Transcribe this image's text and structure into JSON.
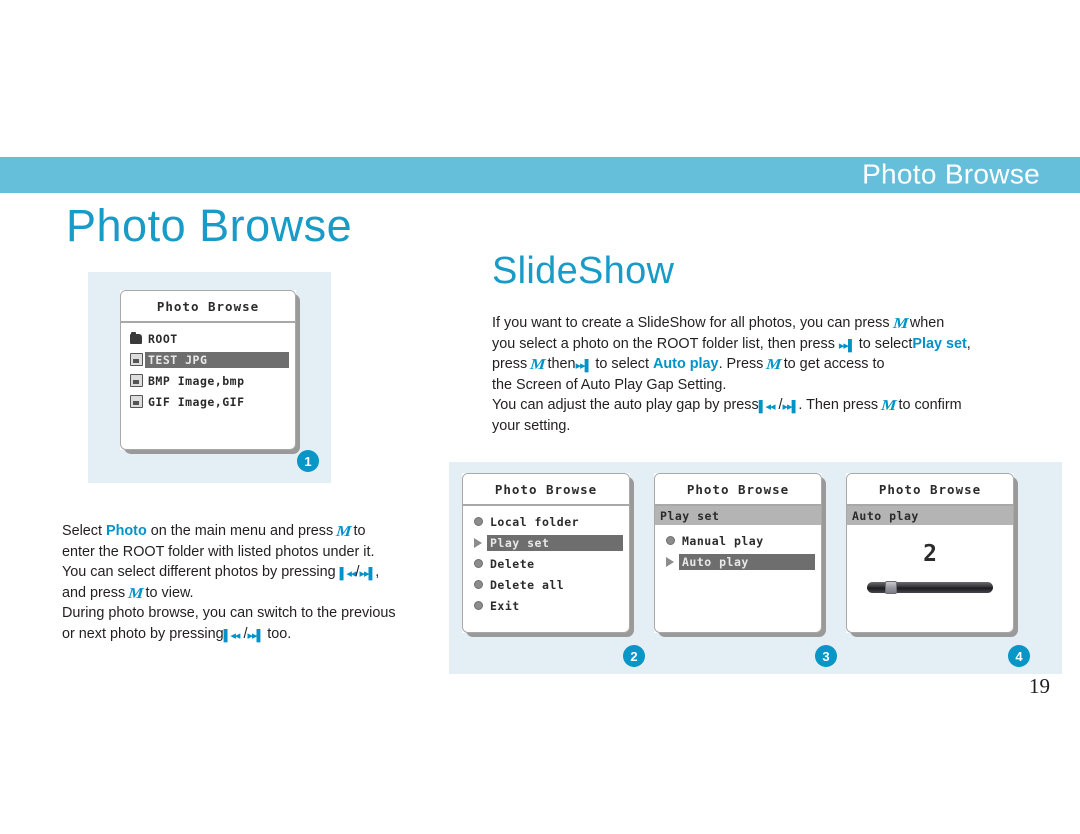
{
  "header": {
    "title": "Photo Browse",
    "band_color": "#65BFDB"
  },
  "page_title": "Photo Browse",
  "section": {
    "title": "SlideShow"
  },
  "accent_color": "#0093C9",
  "title_color": "#189BC6",
  "right_paragraph": {
    "line1_a": "If you want to create a SlideShow for all photos, you can press",
    "icon1": "menu-m-icon",
    "line1_b": "when",
    "line2_a": "you select a photo on the ROOT folder list, then press",
    "icon2": "fast-forward-icon",
    "line2_b": "to select",
    "line2_accent": "Play set",
    "line2_c": ",",
    "line3_a": "press",
    "icon3": "menu-m-icon",
    "line3_b": "then",
    "icon4": "fast-forward-icon",
    "line3_c": "to select",
    "line3_accent": "Auto play",
    "line3_d": ". Press",
    "icon5": "menu-m-icon",
    "line3_e": "to get access to",
    "line4": "the Screen of Auto Play Gap Setting.",
    "line5_a": "You can adjust the auto play gap by press",
    "icon6": "rewind-icon",
    "line5_slash": "/",
    "icon7": "fast-forward-icon",
    "line5_b": ". Then press",
    "icon8": "menu-m-icon",
    "line5_c": "to confirm",
    "line6": "your setting."
  },
  "left_paragraph": {
    "line1_a": "Select",
    "line1_accent": "Photo",
    "line1_b": "on the main menu and press",
    "icon1": "menu-m-icon",
    "line1_c": "to",
    "line2": "enter the ROOT folder with listed photos under it.",
    "line3_a": "You can select different photos by pressing",
    "icon2": "rewind-icon",
    "line3_slash": "/",
    "icon3": "fast-forward-icon",
    "line3_b": ",",
    "line4_a": "and press",
    "icon4": "play-slash-icon",
    "line4_b": "to view.",
    "line5": "During photo browse, you can switch to the previous",
    "line6_a": "or next photo by pressing",
    "icon5": "rewind-icon",
    "line6_slash": "/",
    "icon6": "fast-forward-icon",
    "line6_b": "too."
  },
  "screens": [
    {
      "id": "screen-1",
      "badge": "1",
      "title": "Photo Browse",
      "rows": [
        {
          "icon": "folder-icon",
          "label": "ROOT",
          "selected": false
        },
        {
          "icon": "file-icon",
          "label": "TEST JPG",
          "selected": true
        },
        {
          "icon": "file-icon",
          "label": "BMP Image,bmp",
          "selected": false
        },
        {
          "icon": "file-icon",
          "label": "GIF Image,GIF",
          "selected": false
        }
      ]
    },
    {
      "id": "screen-2",
      "badge": "2",
      "title": "Photo Browse",
      "rows": [
        {
          "icon": "dot-icon",
          "label": "Local folder",
          "selected": false
        },
        {
          "icon": "play-icon",
          "label": "Play set",
          "selected": true
        },
        {
          "icon": "dot-icon",
          "label": "Delete",
          "selected": false
        },
        {
          "icon": "dot-icon",
          "label": "Delete all",
          "selected": false
        },
        {
          "icon": "dot-icon",
          "label": "Exit",
          "selected": false
        }
      ]
    },
    {
      "id": "screen-3",
      "badge": "3",
      "title": "Photo Browse",
      "subheader": "Play set",
      "rows": [
        {
          "icon": "dot-icon",
          "label": "Manual play",
          "selected": false
        },
        {
          "icon": "play-icon",
          "label": "Auto play",
          "selected": true
        }
      ]
    },
    {
      "id": "screen-4",
      "badge": "4",
      "title": "Photo Browse",
      "subheader": "Auto play",
      "gap_value": "2"
    }
  ],
  "page_number": "19"
}
